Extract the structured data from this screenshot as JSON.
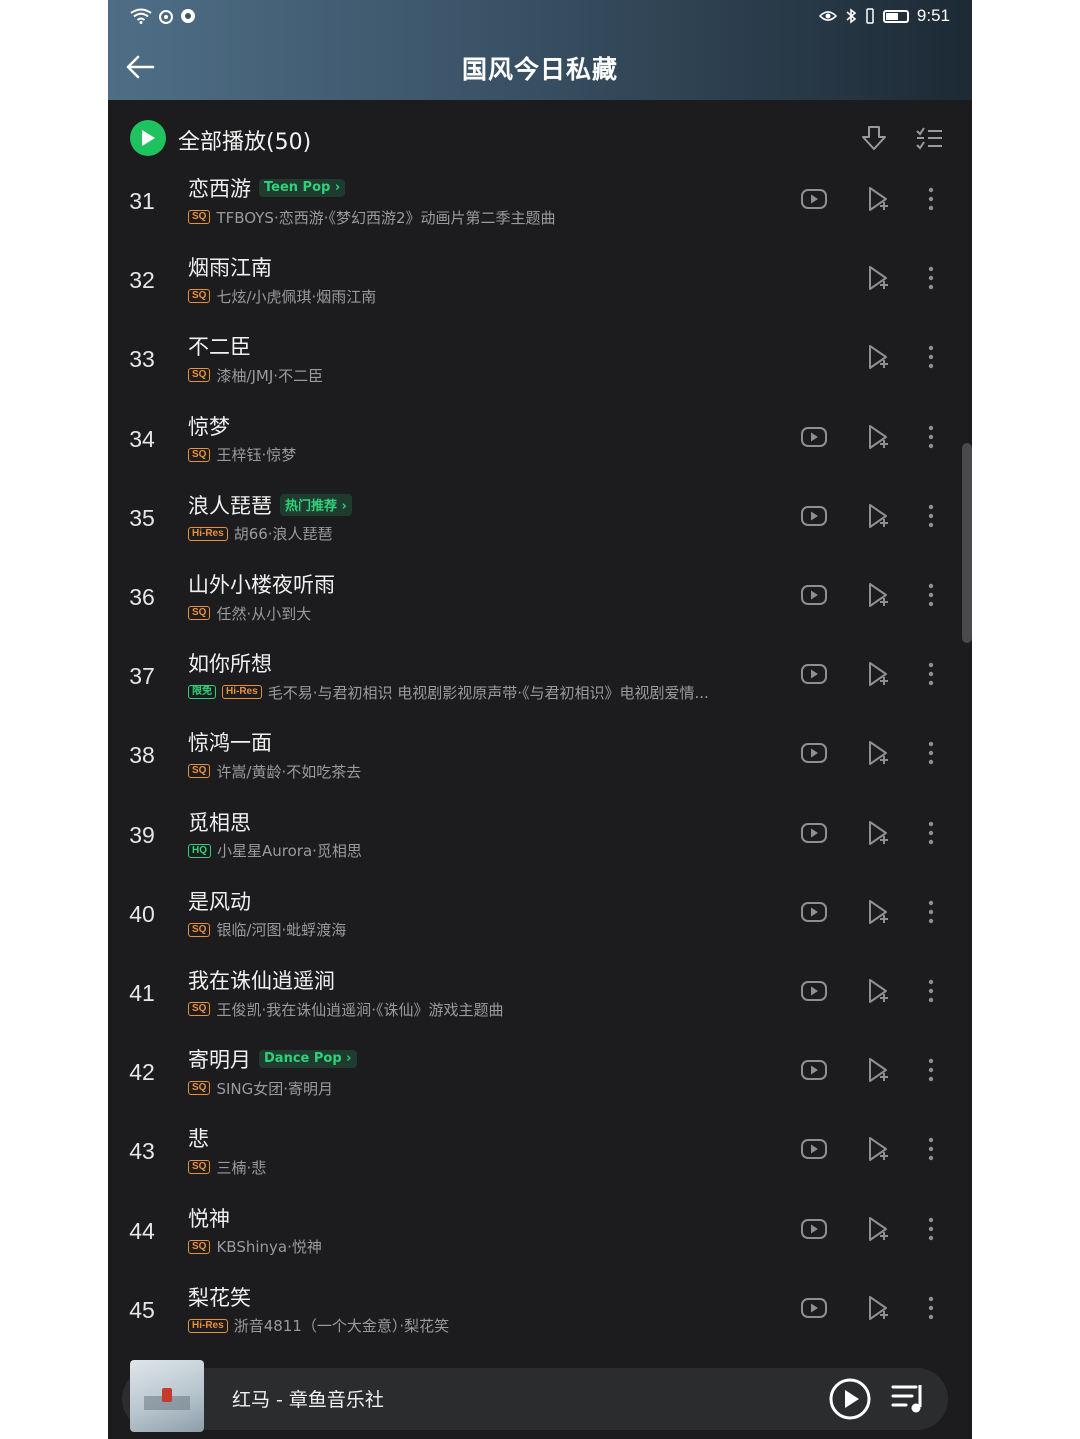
{
  "status_bar": {
    "time": "9:51"
  },
  "header": {
    "title": "国风今日私藏"
  },
  "toolbar": {
    "play_all_label": "全部播放(50)"
  },
  "songs": [
    {
      "index": "31",
      "title": "恋西游",
      "tag": "Teen Pop",
      "badges": [
        "SQ"
      ],
      "subtitle": "TFBOYS·恋西游·《梦幻西游2》动画片第二季主题曲",
      "has_video": true
    },
    {
      "index": "32",
      "title": "烟雨江南",
      "tag": "",
      "badges": [
        "SQ"
      ],
      "subtitle": "七炫/小虎佩琪·烟雨江南",
      "has_video": false
    },
    {
      "index": "33",
      "title": "不二臣",
      "tag": "",
      "badges": [
        "SQ"
      ],
      "subtitle": "漆柚/JMJ·不二臣",
      "has_video": false
    },
    {
      "index": "34",
      "title": "惊梦",
      "tag": "",
      "badges": [
        "SQ"
      ],
      "subtitle": "王梓钰·惊梦",
      "has_video": true
    },
    {
      "index": "35",
      "title": "浪人琵琶",
      "tag": "热门推荐",
      "badges": [
        "Hi-Res"
      ],
      "subtitle": "胡66·浪人琵琶",
      "has_video": true
    },
    {
      "index": "36",
      "title": "山外小楼夜听雨",
      "tag": "",
      "badges": [
        "SQ"
      ],
      "subtitle": "任然·从小到大",
      "has_video": true
    },
    {
      "index": "37",
      "title": "如你所想",
      "tag": "",
      "badges": [
        "限免",
        "Hi-Res"
      ],
      "subtitle": "毛不易·与君初相识 电视剧影视原声带·《与君初相识》电视剧爱情...",
      "has_video": true
    },
    {
      "index": "38",
      "title": "惊鸿一面",
      "tag": "",
      "badges": [
        "SQ"
      ],
      "subtitle": "许嵩/黄龄·不如吃茶去",
      "has_video": true
    },
    {
      "index": "39",
      "title": "觅相思",
      "tag": "",
      "badges": [
        "HQ"
      ],
      "subtitle": "小星星Aurora·觅相思",
      "has_video": true
    },
    {
      "index": "40",
      "title": "是风动",
      "tag": "",
      "badges": [
        "SQ"
      ],
      "subtitle": "银临/河图·蚍蜉渡海",
      "has_video": true
    },
    {
      "index": "41",
      "title": "我在诛仙逍遥涧",
      "tag": "",
      "badges": [
        "SQ"
      ],
      "subtitle": "王俊凯·我在诛仙逍遥涧·《诛仙》游戏主题曲",
      "has_video": true
    },
    {
      "index": "42",
      "title": "寄明月",
      "tag": "Dance Pop",
      "badges": [
        "SQ"
      ],
      "subtitle": "SING女团·寄明月",
      "has_video": true
    },
    {
      "index": "43",
      "title": "悲",
      "tag": "",
      "badges": [
        "SQ"
      ],
      "subtitle": "三楠·悲",
      "has_video": true
    },
    {
      "index": "44",
      "title": "悦神",
      "tag": "",
      "badges": [
        "SQ"
      ],
      "subtitle": "KBShinya·悦神",
      "has_video": true
    },
    {
      "index": "45",
      "title": "梨花笑",
      "tag": "",
      "badges": [
        "Hi-Res"
      ],
      "subtitle": "浙音4811（一个大金意）·梨花笑",
      "has_video": true
    }
  ],
  "mini_player": {
    "now_playing": "红马 - 章鱼音乐社"
  },
  "colors": {
    "accent_green": "#1ec35f",
    "background": "#1c1c1e",
    "quality_orange": "#e8913a"
  },
  "icons": [
    "wifi-icon",
    "back-arrow-icon",
    "download-icon",
    "multi-select-icon",
    "video-icon",
    "add-to-playlist-icon",
    "more-icon",
    "play-icon",
    "playlist-icon"
  ]
}
